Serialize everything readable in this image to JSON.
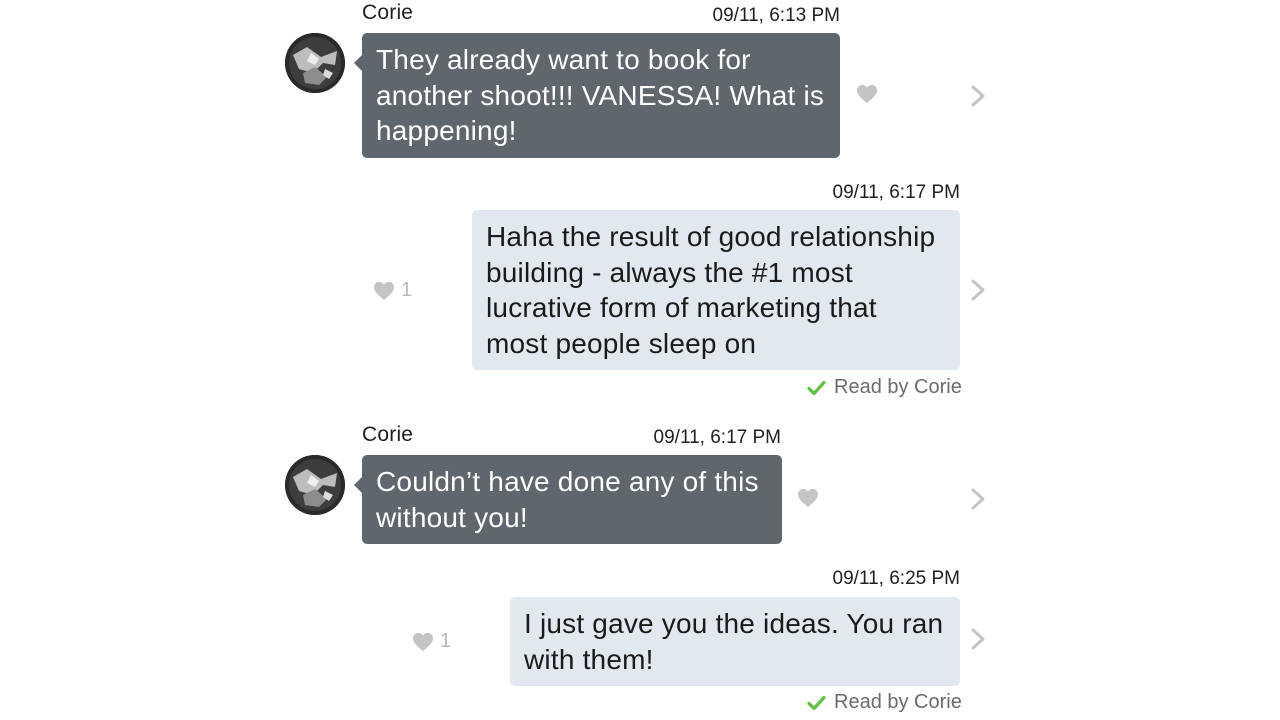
{
  "messages": [
    {
      "direction": "incoming",
      "sender": "Corie",
      "timestamp": "09/11, 6:13 PM",
      "text": "They already want to book for another shoot!!!  VANESSA! What is happening!",
      "likes": ""
    },
    {
      "direction": "outgoing",
      "timestamp": "09/11, 6:17 PM",
      "text": "Haha the result of good relationship building - always the #1 most lucrative form of marketing that most people sleep on",
      "likes": "1",
      "read_receipt": "Read by Corie"
    },
    {
      "direction": "incoming",
      "sender": "Corie",
      "timestamp": "09/11, 6:17 PM",
      "text": "Couldn’t have done any of this without you!",
      "likes": ""
    },
    {
      "direction": "outgoing",
      "timestamp": "09/11, 6:25 PM",
      "text": "I just gave you the ideas. You ran with them!",
      "likes": "1",
      "read_receipt": "Read by Corie"
    }
  ],
  "icons": {
    "like": "heart-icon",
    "details": "chevron-right-icon",
    "read": "checkmark-icon",
    "avatar": "avatar"
  },
  "colors": {
    "incoming_bubble": "#5f666d",
    "outgoing_bubble": "#e2e8ef",
    "read_check": "#5cc33a",
    "icon_gray": "#c4c4c4"
  }
}
